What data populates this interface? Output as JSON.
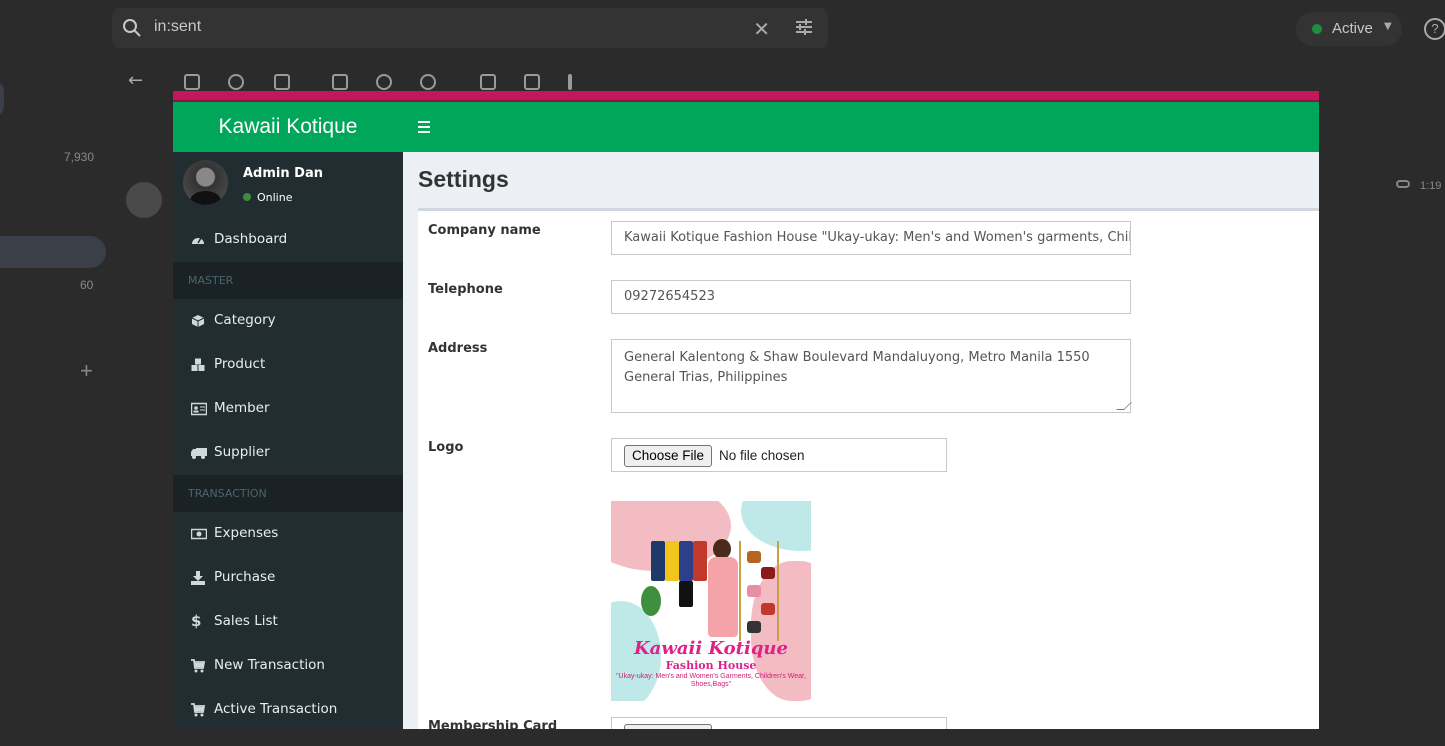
{
  "background": {
    "search_query": "in:sent",
    "status_label": "Active",
    "counts": [
      "7,930",
      "60"
    ],
    "time_label": "1:19 ",
    "help_label": "?"
  },
  "app": {
    "brand": "Kawaii Kotique",
    "accent_color": "#00a65a",
    "sidebar_color": "#222d32",
    "topbar_color": "#c2185b"
  },
  "user": {
    "name": "Admin Dan",
    "status": "Online"
  },
  "sidebar": {
    "dashboard": {
      "label": "Dashboard",
      "icon": "dashboard-icon"
    },
    "master_header": "MASTER",
    "master_items": [
      {
        "label": "Category",
        "icon": "cube-icon"
      },
      {
        "label": "Product",
        "icon": "cubes-icon"
      },
      {
        "label": "Member",
        "icon": "id-card-icon"
      },
      {
        "label": "Supplier",
        "icon": "truck-icon"
      }
    ],
    "transaction_header": "TRANSACTION",
    "transaction_items": [
      {
        "label": "Expenses",
        "icon": "money-icon"
      },
      {
        "label": "Purchase",
        "icon": "download-icon"
      },
      {
        "label": "Sales List",
        "icon": "dollar-icon"
      },
      {
        "label": "New Transaction",
        "icon": "cart-icon"
      },
      {
        "label": "Active Transaction",
        "icon": "cart-icon"
      }
    ]
  },
  "page": {
    "title": "Settings"
  },
  "form": {
    "company_name_label": "Company name",
    "company_name_value": "Kawaii Kotique Fashion House \"Ukay-ukay: Men's and Women's garments, Children's",
    "telephone_label": "Telephone",
    "telephone_value": "09272654523",
    "address_label": "Address",
    "address_value": "General Kalentong & Shaw Boulevard Mandaluyong, Metro Manila 1550 General Trias, Philippines",
    "logo_label": "Logo",
    "file_button": "Choose File",
    "file_none": "No file chosen",
    "membership_label": "Membership Card"
  },
  "logo_image": {
    "title": "Kawaii Kotique",
    "subtitle": "Fashion House",
    "tagline": "\"Ukay-ukay: Men's and Women's Garments, Children's Wear, Shoes,Bags\""
  }
}
